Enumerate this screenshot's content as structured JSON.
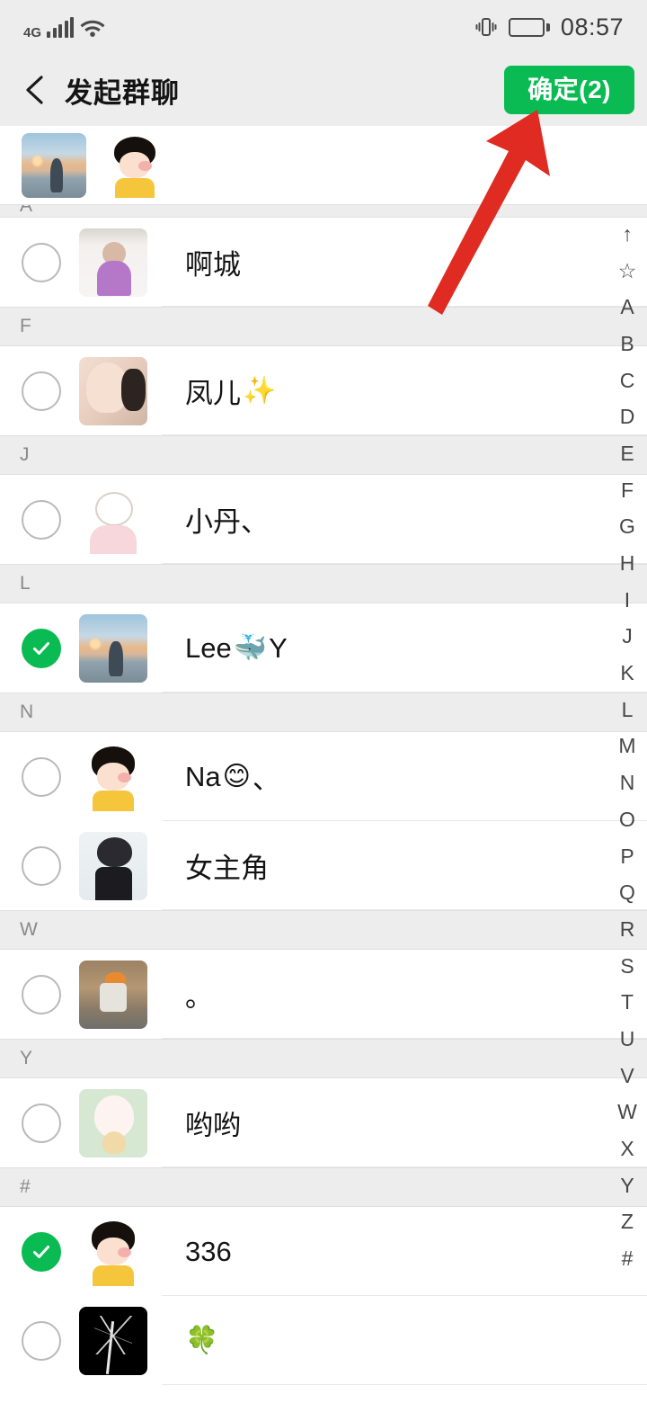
{
  "status_bar": {
    "network_label": "4G",
    "time": "08:57",
    "icons": [
      "signal-bars-icon",
      "wifi-icon",
      "vibrate-icon",
      "battery-icon"
    ]
  },
  "nav": {
    "back_icon": "back-chevron-icon",
    "title": "发起群聊",
    "confirm_label": "确定(2)",
    "confirm_color": "#09bb52"
  },
  "selected": {
    "count": 2,
    "avatars": [
      {
        "name": "Lee🐳 Y",
        "art": "av-sunset"
      },
      {
        "name": "336",
        "art": "av-maruko"
      }
    ]
  },
  "list": [
    {
      "type": "section",
      "label": "A",
      "clipped": true
    },
    {
      "type": "contact",
      "name": "啊城",
      "checked": false,
      "art": "av-couple"
    },
    {
      "type": "section",
      "label": "F",
      "clipped": false
    },
    {
      "type": "contact",
      "name": "凤儿",
      "emoji": "✨",
      "checked": false,
      "art": "av-girl"
    },
    {
      "type": "section",
      "label": "J",
      "clipped": false
    },
    {
      "type": "contact",
      "name": "小丹、",
      "checked": false,
      "art": "av-sketch"
    },
    {
      "type": "section",
      "label": "L",
      "clipped": false
    },
    {
      "type": "contact",
      "name": "Lee",
      "emoji": "🐳",
      "name_suffix": " Y",
      "checked": true,
      "art": "av-sunset"
    },
    {
      "type": "section",
      "label": "N",
      "clipped": false
    },
    {
      "type": "contact",
      "name": "Na",
      "emoji": "😊",
      "name_suffix": "、",
      "checked": false,
      "art": "av-maruko"
    },
    {
      "type": "contact",
      "name": "女主角",
      "checked": false,
      "art": "av-cat"
    },
    {
      "type": "section",
      "label": "W",
      "clipped": false
    },
    {
      "type": "contact",
      "name": "。",
      "checked": false,
      "art": "av-child"
    },
    {
      "type": "section",
      "label": "Y",
      "clipped": false
    },
    {
      "type": "contact",
      "name": "哟哟",
      "checked": false,
      "art": "av-bunny"
    },
    {
      "type": "section",
      "label": "#",
      "clipped": false
    },
    {
      "type": "contact",
      "name": "336",
      "checked": true,
      "art": "av-maruko"
    },
    {
      "type": "contact",
      "name": "",
      "emoji": "🍀",
      "checked": false,
      "art": "av-tree"
    }
  ],
  "index_bar": {
    "entries": [
      "↑",
      "☆",
      "A",
      "B",
      "C",
      "D",
      "E",
      "F",
      "G",
      "H",
      "I",
      "J",
      "K",
      "L",
      "M",
      "N",
      "O",
      "P",
      "Q",
      "R",
      "S",
      "T",
      "U",
      "V",
      "W",
      "X",
      "Y",
      "Z",
      "#"
    ]
  },
  "annotation": {
    "arrow_color": "#df2b21",
    "points_to": "confirm-button"
  }
}
